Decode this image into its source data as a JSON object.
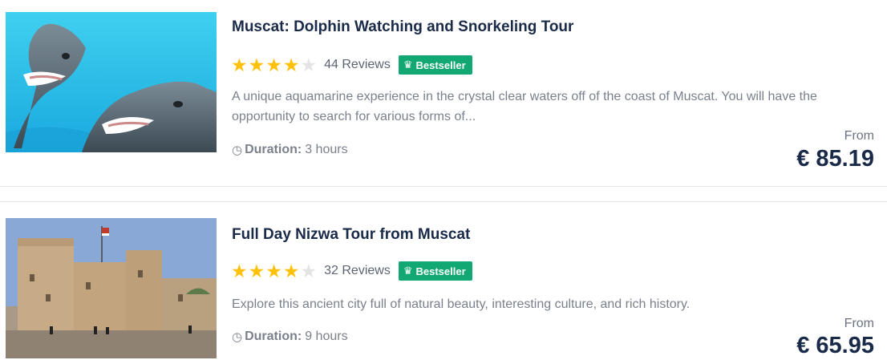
{
  "tours": [
    {
      "title": "Muscat: Dolphin Watching and Snorkeling Tour",
      "rating_stars": 4,
      "reviews": "44 Reviews",
      "badge": "Bestseller",
      "description": "A unique aquamarine experience in the crystal clear waters off of the coast of Muscat. You will have the opportunity to search for various forms of...",
      "duration_label": "Duration:",
      "duration_value": "3 hours",
      "from_label": "From",
      "price": "€ 85.19",
      "image": "dolphins-photo"
    },
    {
      "title": "Full Day Nizwa Tour from Muscat",
      "rating_stars": 4,
      "reviews": "32 Reviews",
      "badge": "Bestseller",
      "description": "Explore this ancient city full of natural beauty, interesting culture, and rich history.",
      "duration_label": "Duration:",
      "duration_value": "9 hours",
      "from_label": "From",
      "price": "€ 65.95",
      "image": "fort-photo"
    }
  ],
  "colors": {
    "title": "#1a2b49",
    "star": "#ffc107",
    "star_empty": "#e4e4e4",
    "badge": "#12a873",
    "muted_text": "#7a818c"
  }
}
